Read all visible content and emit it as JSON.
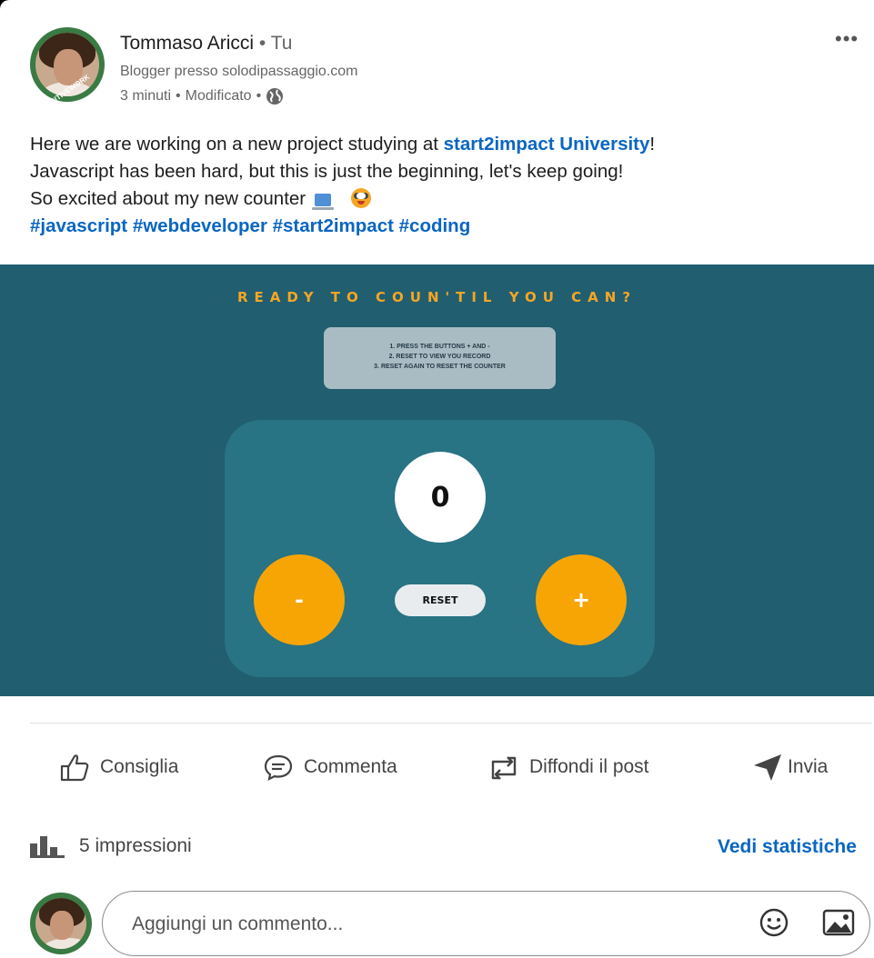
{
  "post": {
    "author_name": "Tommaso Aricci",
    "author_you": "Tu",
    "author_headline": "Blogger presso solodipassaggio.com",
    "time": "3 minuti",
    "edited": "Modificato",
    "text_line1_pre": "Here we are working on a new project studying at ",
    "text_line1_link": "start2impact University",
    "text_line1_post": "!",
    "text_line2": "Javascript has been hard, but this is just the beginning, let's keep going!",
    "text_line3": "So excited about my new counter",
    "hashtags": "#javascript #webdeveloper #start2impact #coding",
    "avatar_badge": "POSITIVEWORK"
  },
  "shot": {
    "title": "READY TO COUN'TIL YOU CAN?",
    "instruction_1": "1. PRESS THE BUTTONS + AND -",
    "instruction_2": "2. RESET TO VIEW YOU RECORD",
    "instruction_3": "3. RESET AGAIN TO RESET THE COUNTER",
    "counter_value": "0",
    "minus_label": "-",
    "plus_label": "+",
    "reset_label": "RESET",
    "bg_color": "#215e70",
    "accent_color": "#f7a505"
  },
  "actions": {
    "like": "Consiglia",
    "comment": "Commenta",
    "repost": "Diffondi il post",
    "send": "Invia"
  },
  "stats": {
    "impressions": "5 impressioni",
    "view_stats": "Vedi statistiche"
  },
  "comment": {
    "placeholder": "Aggiungi un commento..."
  },
  "colors": {
    "link": "#0a66c2"
  }
}
